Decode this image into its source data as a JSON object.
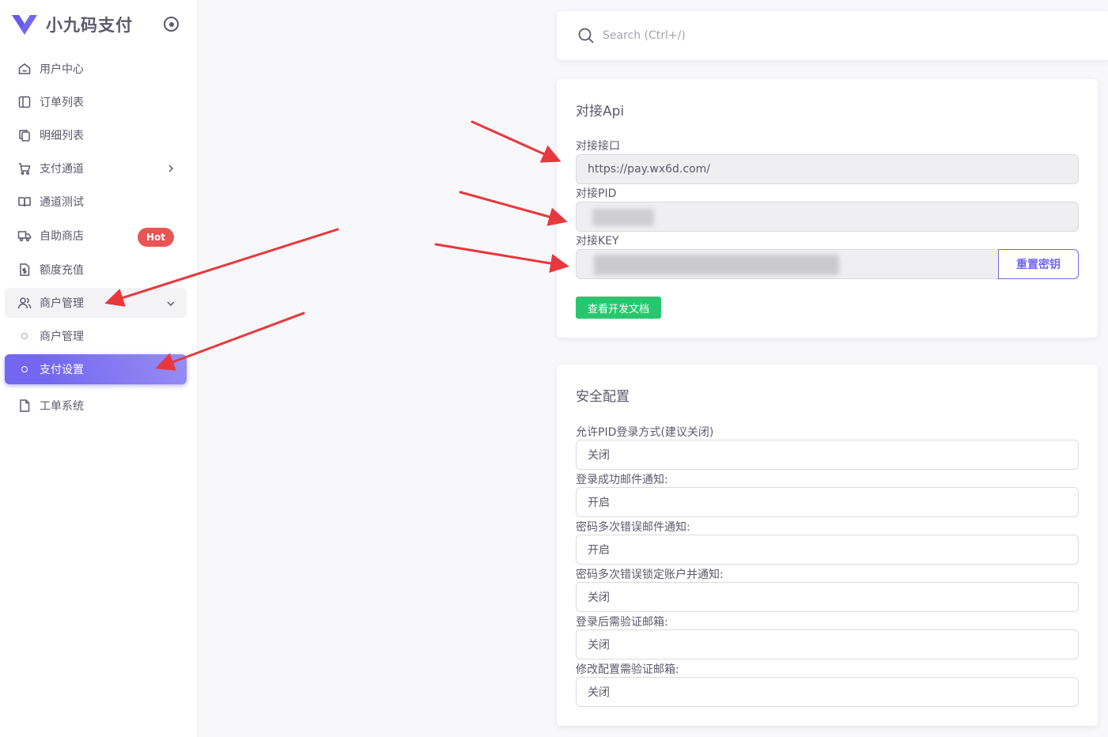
{
  "brand": {
    "name": "小九码支付",
    "logo_icon": "v-logo-icon",
    "accent": "#7367f0"
  },
  "sidebar": {
    "items": [
      {
        "label": "用户中心",
        "icon": "home-icon"
      },
      {
        "label": "订单列表",
        "icon": "layout-icon"
      },
      {
        "label": "明细列表",
        "icon": "copy-icon"
      },
      {
        "label": "支付通道",
        "icon": "cart-icon"
      },
      {
        "label": "通道测试",
        "icon": "book-icon"
      },
      {
        "label": "自助商店",
        "icon": "truck-icon",
        "badge": "Hot"
      },
      {
        "label": "额度充值",
        "icon": "dollar-file-icon"
      },
      {
        "label": "商户管理",
        "icon": "users-icon"
      },
      {
        "label": "商户管理"
      },
      {
        "label": "支付设置"
      },
      {
        "label": "工单系统",
        "icon": "file-icon"
      }
    ]
  },
  "search": {
    "placeholder": "Search (Ctrl+/)"
  },
  "api_card": {
    "title": "对接Api",
    "url_label": "对接接口",
    "url_value": "https://pay.wx6d.com/",
    "pid_label": "对接PID",
    "key_label": "对接KEY",
    "reset_button": "重置密钥",
    "doc_button": "查看开发文档"
  },
  "security_card": {
    "title": "安全配置",
    "fields": [
      {
        "label": "允许PID登录方式(建议关闭)",
        "value": "关闭"
      },
      {
        "label": "登录成功邮件通知:",
        "value": "开启"
      },
      {
        "label": "密码多次错误邮件通知:",
        "value": "开启"
      },
      {
        "label": "密码多次错误锁定账户并通知:",
        "value": "关闭"
      },
      {
        "label": "登录后需验证邮箱:",
        "value": "关闭"
      },
      {
        "label": "修改配置需验证邮箱:",
        "value": "关闭"
      }
    ]
  },
  "colors": {
    "primary": "#7367f0",
    "success": "#28c76f",
    "danger": "#ea5455",
    "annotation_arrow": "#e8383d"
  }
}
